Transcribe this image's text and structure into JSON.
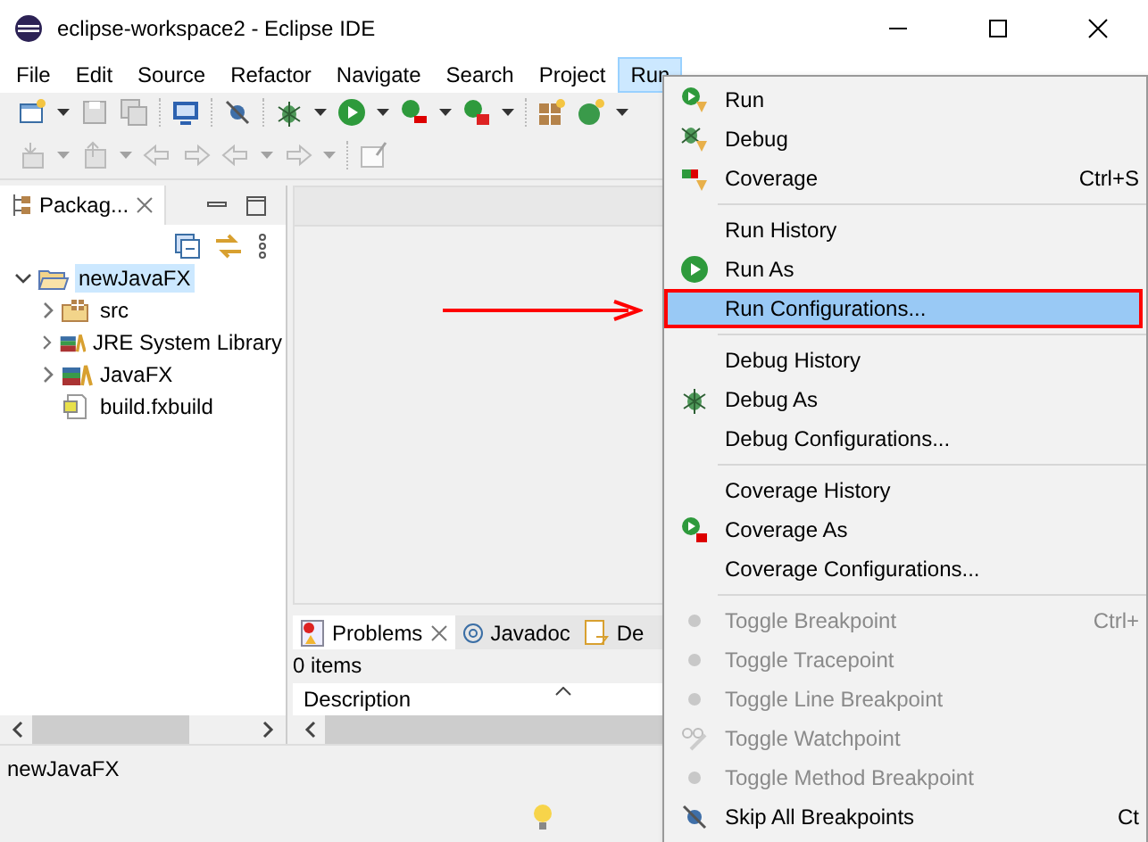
{
  "window": {
    "title": "eclipse-workspace2 - Eclipse IDE"
  },
  "menubar": [
    {
      "label": "File",
      "selected": false
    },
    {
      "label": "Edit",
      "selected": false
    },
    {
      "label": "Source",
      "selected": false
    },
    {
      "label": "Refactor",
      "selected": false
    },
    {
      "label": "Navigate",
      "selected": false
    },
    {
      "label": "Search",
      "selected": false
    },
    {
      "label": "Project",
      "selected": false
    },
    {
      "label": "Run",
      "selected": true
    }
  ],
  "package_explorer": {
    "tab": "Packag...",
    "tree": [
      {
        "label": "newJavaFX",
        "selected": true,
        "expanded": true,
        "children": [
          {
            "label": "src",
            "selected": false,
            "expanded": false
          },
          {
            "label": "JRE System Library",
            "selected": false,
            "expanded": false
          },
          {
            "label": "JavaFX",
            "selected": false,
            "expanded": false
          },
          {
            "label": "build.fxbuild",
            "selected": false
          }
        ]
      }
    ]
  },
  "bottom_panel": {
    "tabs": [
      {
        "label": "Problems",
        "selected": true
      },
      {
        "label": "Javadoc",
        "selected": false
      },
      {
        "label": "De",
        "selected": false
      }
    ],
    "summary": "0 items",
    "columns": [
      "Description"
    ]
  },
  "status_bar": {
    "text": "newJavaFX"
  },
  "run_menu": [
    [
      {
        "label": "Run",
        "disabled": false,
        "selected": false
      },
      {
        "label": "Debug",
        "disabled": false,
        "selected": false
      },
      {
        "label": "Coverage",
        "shortcut": "Ctrl+S",
        "disabled": false,
        "selected": false
      }
    ],
    [
      {
        "label": "Run History",
        "disabled": false,
        "selected": false
      },
      {
        "label": "Run As",
        "disabled": false,
        "selected": false
      },
      {
        "label": "Run Configurations...",
        "disabled": false,
        "selected": true
      }
    ],
    [
      {
        "label": "Debug History",
        "disabled": false,
        "selected": false
      },
      {
        "label": "Debug As",
        "disabled": false,
        "selected": false
      },
      {
        "label": "Debug Configurations...",
        "disabled": false,
        "selected": false
      }
    ],
    [
      {
        "label": "Coverage History",
        "disabled": false,
        "selected": false
      },
      {
        "label": "Coverage As",
        "disabled": false,
        "selected": false
      },
      {
        "label": "Coverage Configurations...",
        "disabled": false,
        "selected": false
      }
    ],
    [
      {
        "label": "Toggle Breakpoint",
        "shortcut": "Ctrl+",
        "disabled": true,
        "selected": false
      },
      {
        "label": "Toggle Tracepoint",
        "disabled": true,
        "selected": false
      },
      {
        "label": "Toggle Line Breakpoint",
        "disabled": true,
        "selected": false
      },
      {
        "label": "Toggle Watchpoint",
        "disabled": true,
        "selected": false
      },
      {
        "label": "Toggle Method Breakpoint",
        "disabled": true,
        "selected": false
      },
      {
        "label": "Skip All Breakpoints",
        "shortcut": "Ct",
        "disabled": false,
        "selected": false
      }
    ]
  ]
}
